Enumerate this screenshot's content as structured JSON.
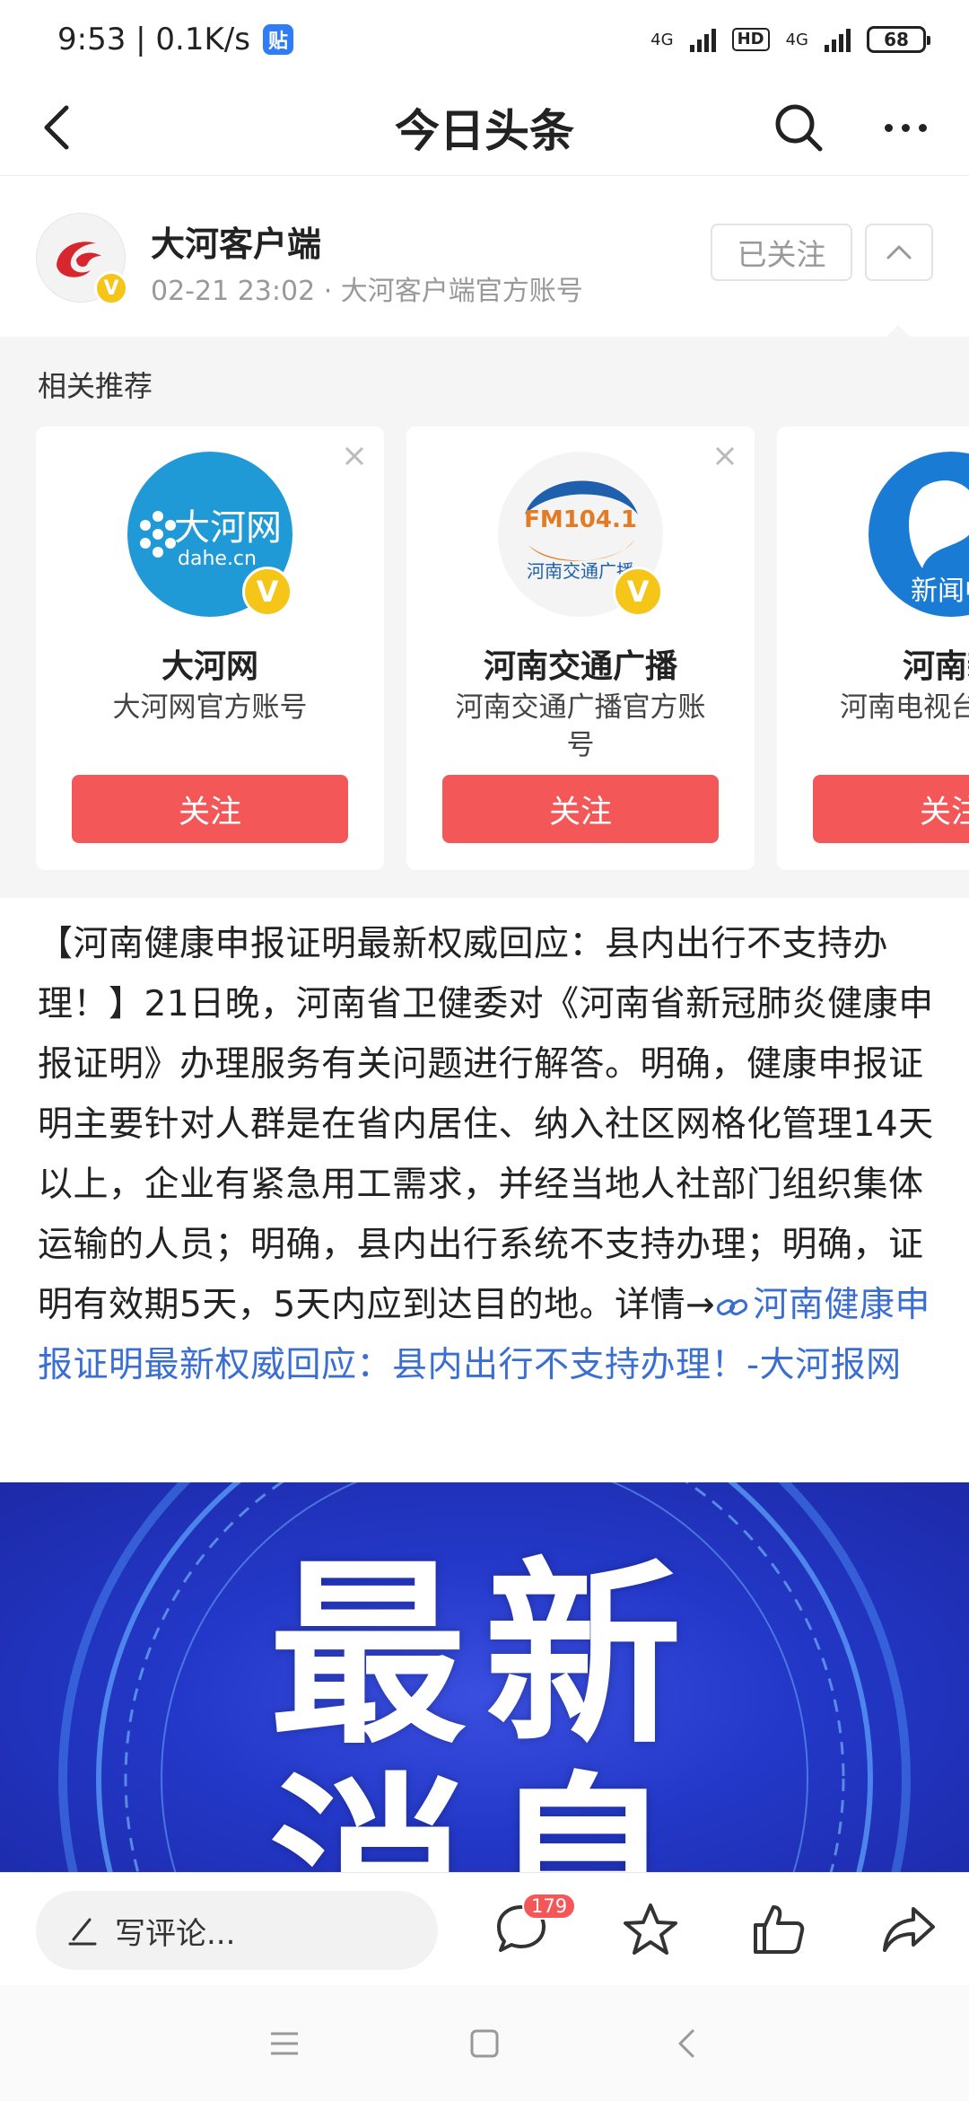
{
  "status_bar": {
    "time_speed": "9:53 | 0.1K/s",
    "app_badge": "贴",
    "net1": "4G",
    "hd": "HD",
    "net2": "4G",
    "battery": "68"
  },
  "nav": {
    "title": "今日头条",
    "icons": [
      "back-icon",
      "search-icon",
      "more-icon"
    ]
  },
  "author": {
    "name": "大河客户端",
    "meta": "02-21 23:02 · 大河客户端官方账号",
    "follow_label": "已关注",
    "verified_mark": "V"
  },
  "recommend": {
    "title": "相关推荐",
    "follow_label": "关注",
    "cards": [
      {
        "name": "大河网",
        "desc": "大河网官方账号",
        "logo_text": "大河网",
        "logo_sub": "dahe.cn",
        "logo_color": "#1f9ad6"
      },
      {
        "name": "河南交通广播",
        "desc": "河南交通广播官方账号",
        "logo_text": "FM104.1",
        "logo_sub": "河南交通广播",
        "logo_color": "#1e5fae"
      },
      {
        "name": "河南新",
        "desc": "河南电视台官方账",
        "logo_text": "新闻中",
        "logo_sub": "",
        "logo_color": "#1a7bd4"
      }
    ]
  },
  "article": {
    "body": "【河南健康申报证明最新权威回应：县内出行不支持办理！】21日晚，河南省卫健委对《河南省新冠肺炎健康申报证明》办理服务有关问题进行解答。明确，健康申报证明主要针对人群是在省内居住、纳入社区网格化管理14天以上，企业有紧急用工需求，并经当地人社部门组织集体运输的人员；明确，县内出行系统不支持办理；明确，证明有效期5天，5天内应到达目的地。详情→",
    "link_text": "河南健康申报证明最新权威回应：县内出行不支持办理！-大河报网"
  },
  "banner": {
    "line1": "最新",
    "line2": "消息",
    "color": "#2338c8"
  },
  "action_bar": {
    "comment_placeholder": "写评论...",
    "comment_count": "179",
    "icons": [
      "comment-icon",
      "star-icon",
      "like-icon",
      "share-icon"
    ]
  },
  "colors": {
    "accent_red": "#f35757",
    "link_blue": "#3a6fd1",
    "verified_yellow": "#f5c518"
  }
}
